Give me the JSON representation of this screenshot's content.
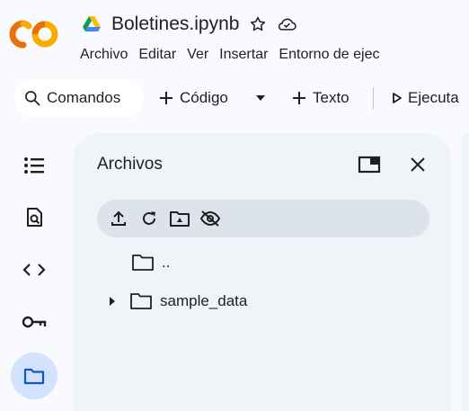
{
  "app": {
    "logo_text": "CO",
    "doc_title": "Boletines.ipynb"
  },
  "menu": [
    "Archivo",
    "Editar",
    "Ver",
    "Insertar",
    "Entorno de ejec"
  ],
  "toolbar": {
    "commands_label": "Comandos",
    "code_label": "Código",
    "text_label": "Texto",
    "run_label": "Ejecuta"
  },
  "sidebar": {
    "items": [
      {
        "icon": "table-of-contents-icon"
      },
      {
        "icon": "find-in-document-icon"
      },
      {
        "icon": "code-icon"
      },
      {
        "icon": "key-icon"
      },
      {
        "icon": "folder-icon",
        "active": true
      }
    ]
  },
  "files_panel": {
    "title": "Archivos",
    "tree": [
      {
        "name": "..",
        "type": "folder",
        "expandable": false
      },
      {
        "name": "sample_data",
        "type": "folder",
        "expandable": true
      }
    ]
  },
  "colors": {
    "background": "#f8fafd",
    "panel": "#f0f4f9",
    "active_rail": "#d3e3fd",
    "file_toolbar": "#dde3ea",
    "logo_orange": "#f9ab00",
    "logo_dark_orange": "#e8710a"
  }
}
